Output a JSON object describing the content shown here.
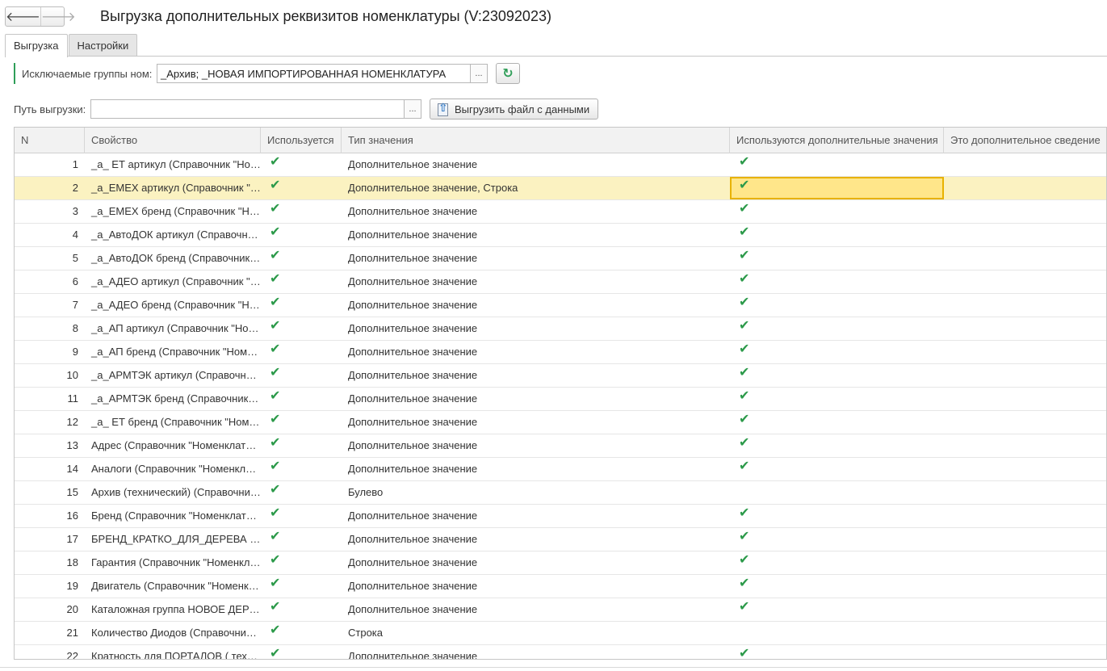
{
  "window": {
    "title": "Выгрузка дополнительных реквизитов номенклатуры (V:23092023)"
  },
  "nav": {
    "back": "🡐",
    "forward": "🡒"
  },
  "tabs": [
    {
      "label": "Выгрузка",
      "active": true
    },
    {
      "label": "Настройки",
      "active": false
    }
  ],
  "filters": {
    "excluded_label": "Исключаемые группы ном:",
    "excluded_value": "_Архив; _НОВАЯ ИМПОРТИРОВАННАЯ НОМЕНКЛАТУРА",
    "dots": "...",
    "path_label": "Путь выгрузки:",
    "path_value": "",
    "export_button": "Выгрузить файл с данными"
  },
  "table": {
    "columns": [
      "N",
      "Свойство",
      "Используется",
      "Тип значения",
      "Используются дополнительные значения",
      "Это дополнительное сведение"
    ],
    "check_glyph": "✔",
    "selected_row": 2,
    "rows": [
      {
        "n": "1",
        "name": "_а_ ЕТ артикул (Справочник \"Номенклатура\")",
        "used": true,
        "type": "Дополнительное значение",
        "extra": true
      },
      {
        "n": "2",
        "name": "_а_EMEX артикул (Справочник \"Номенклатура\")",
        "used": true,
        "type": "Дополнительное значение, Строка",
        "extra": true
      },
      {
        "n": "3",
        "name": "_а_EMEX бренд (Справочник \"Номенклатура\")",
        "used": true,
        "type": "Дополнительное значение",
        "extra": true
      },
      {
        "n": "4",
        "name": "_а_АвтоДОК артикул (Справочник \"Номенклатура\")",
        "used": true,
        "type": "Дополнительное значение",
        "extra": true
      },
      {
        "n": "5",
        "name": "_а_АвтоДОК бренд (Справочник \"Номенклатура\")",
        "used": true,
        "type": "Дополнительное значение",
        "extra": true
      },
      {
        "n": "6",
        "name": "_а_АДЕО артикул (Справочник \"Номенклатура\")",
        "used": true,
        "type": "Дополнительное значение",
        "extra": true
      },
      {
        "n": "7",
        "name": "_а_АДЕО бренд (Справочник \"Номенклатура\")",
        "used": true,
        "type": "Дополнительное значение",
        "extra": true
      },
      {
        "n": "8",
        "name": "_а_АП артикул (Справочник \"Номенклатура\")",
        "used": true,
        "type": "Дополнительное значение",
        "extra": true
      },
      {
        "n": "9",
        "name": "_а_АП бренд (Справочник \"Номенклатура\")",
        "used": true,
        "type": "Дополнительное значение",
        "extra": true
      },
      {
        "n": "10",
        "name": "_а_АРМТЭК артикул (Справочник \"Номенклатура\")",
        "used": true,
        "type": "Дополнительное значение",
        "extra": true
      },
      {
        "n": "11",
        "name": "_а_АРМТЭК бренд (Справочник \"Номенклатура\")",
        "used": true,
        "type": "Дополнительное значение",
        "extra": true
      },
      {
        "n": "12",
        "name": "_а_ ЕТ бренд (Справочник \"Номенклатура\")",
        "used": true,
        "type": "Дополнительное значение",
        "extra": true
      },
      {
        "n": "13",
        "name": "Адрес (Справочник \"Номенклатура\")",
        "used": true,
        "type": "Дополнительное значение",
        "extra": true
      },
      {
        "n": "14",
        "name": "Аналоги (Справочник \"Номенклатура\")",
        "used": true,
        "type": "Дополнительное значение",
        "extra": true
      },
      {
        "n": "15",
        "name": "Архив (технический) (Справочник \"Номенклатура\")",
        "used": true,
        "type": "Булево",
        "extra": false
      },
      {
        "n": "16",
        "name": "Бренд (Справочник \"Номенклатура\")",
        "used": true,
        "type": "Дополнительное значение",
        "extra": true
      },
      {
        "n": "17",
        "name": "БРЕНД_КРАТКО_ДЛЯ_ДЕРЕВА (Справочник \"Номенклатура\")",
        "used": true,
        "type": "Дополнительное значение",
        "extra": true
      },
      {
        "n": "18",
        "name": "Гарантия (Справочник \"Номенклатура\")",
        "used": true,
        "type": "Дополнительное значение",
        "extra": true
      },
      {
        "n": "19",
        "name": "Двигатель (Справочник \"Номенклатура\")",
        "used": true,
        "type": "Дополнительное значение",
        "extra": true
      },
      {
        "n": "20",
        "name": "Каталожная группа НОВОЕ ДЕРЕВО (Справочник \"Номенклатура\")",
        "used": true,
        "type": "Дополнительное значение",
        "extra": true
      },
      {
        "n": "21",
        "name": "Количество  Диодов (Справочник \"Номенклатура\")",
        "used": true,
        "type": "Строка",
        "extra": false
      },
      {
        "n": "22",
        "name": "Кратность для ПОРТАЛОВ ( технический) (Справочник \"Номенклатура\")",
        "used": true,
        "type": "Дополнительное значение",
        "extra": true
      }
    ]
  }
}
